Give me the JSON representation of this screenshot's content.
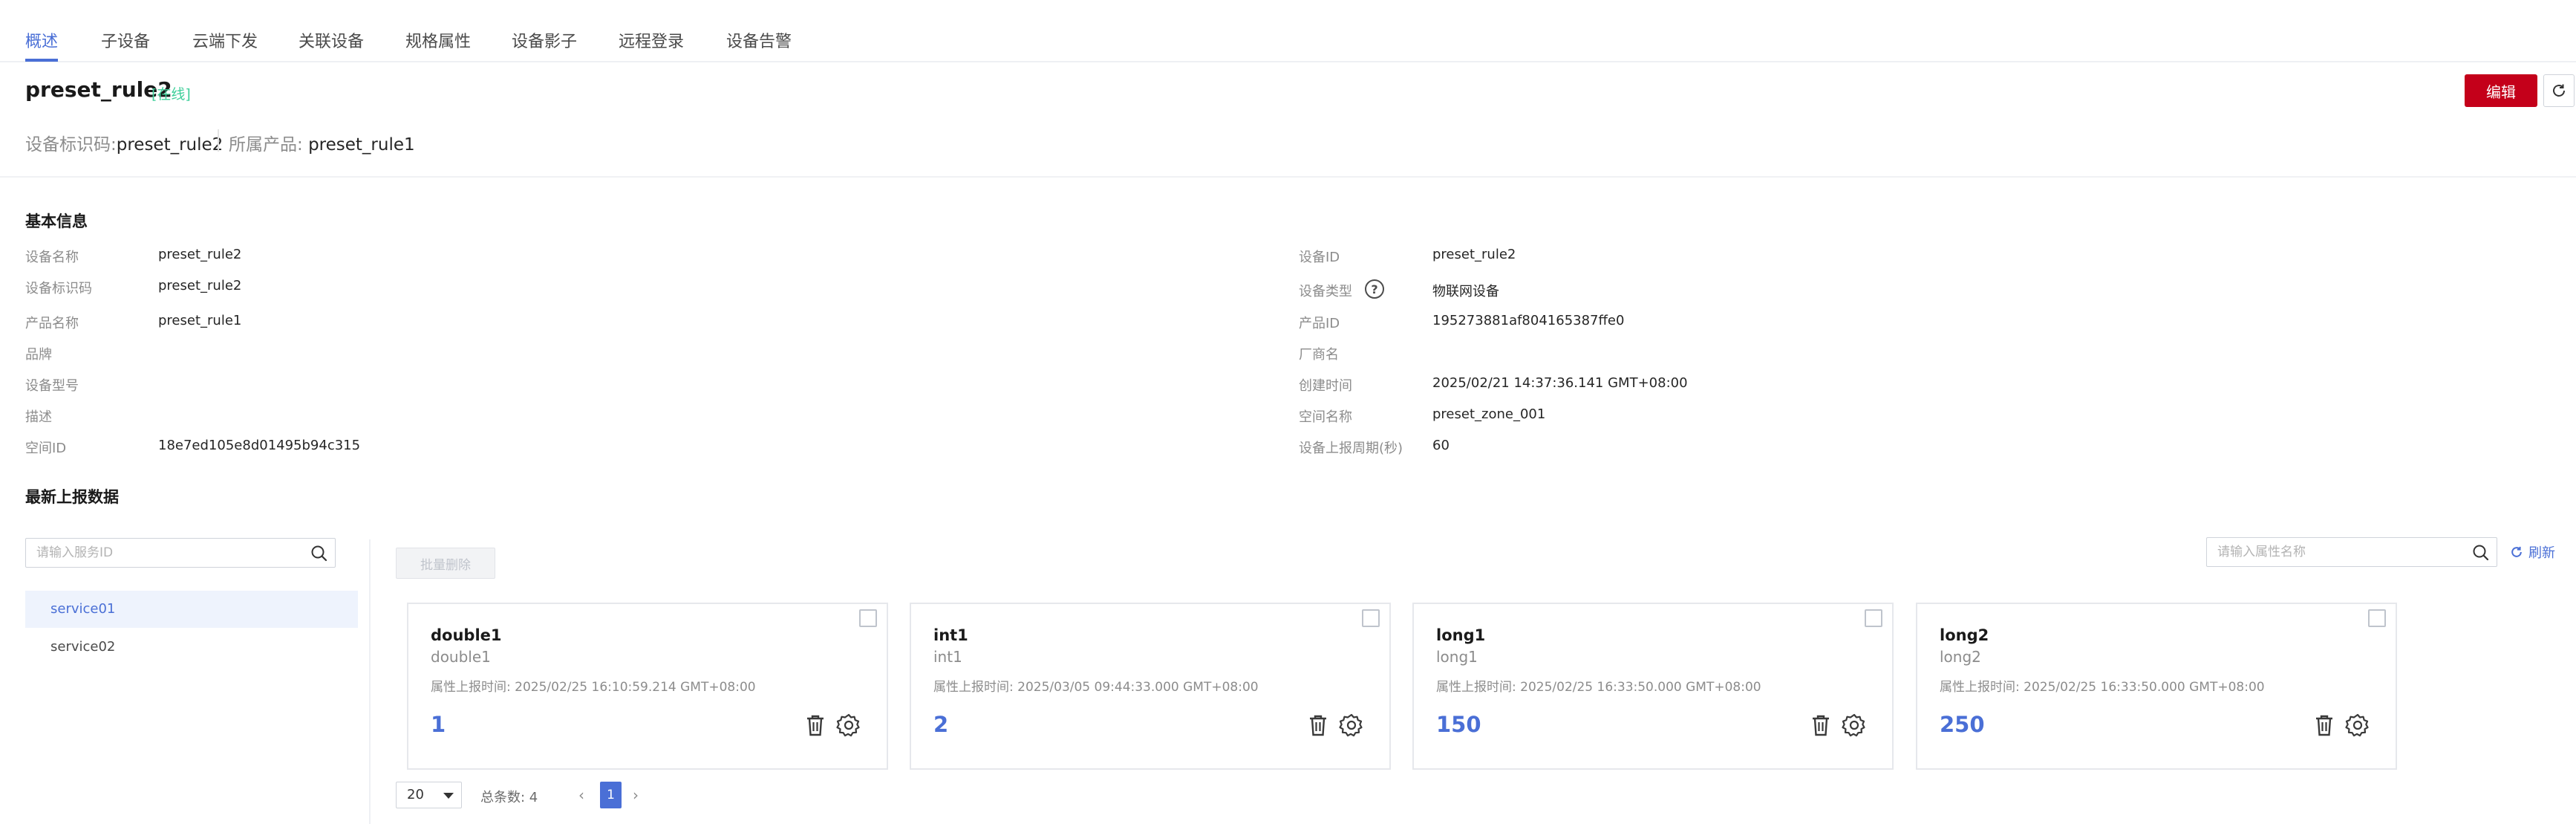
{
  "tabs": [
    "概述",
    "子设备",
    "云端下发",
    "关联设备",
    "规格属性",
    "设备影子",
    "远程登录",
    "设备告警"
  ],
  "header": {
    "device_name": "preset_rule2",
    "status": "[在线]",
    "edit_label": "编辑",
    "meta_code_label": "设备标识码:",
    "meta_code_value": "preset_rule2",
    "meta_product_label": "所属产品:",
    "meta_product_value": "preset_rule1"
  },
  "basic_info": {
    "title": "基本信息",
    "left": [
      {
        "label": "设备名称",
        "value": "preset_rule2"
      },
      {
        "label": "设备标识码",
        "value": "preset_rule2"
      },
      {
        "label": "产品名称",
        "value": "preset_rule1"
      },
      {
        "label": "品牌",
        "value": ""
      },
      {
        "label": "设备型号",
        "value": ""
      },
      {
        "label": "描述",
        "value": ""
      },
      {
        "label": "空间ID",
        "value": "18e7ed105e8d01495b94c315"
      }
    ],
    "right": [
      {
        "label": "设备ID",
        "value": "preset_rule2"
      },
      {
        "label": "设备类型",
        "value": "物联网设备"
      },
      {
        "label": "产品ID",
        "value": "195273881af804165387ffe0"
      },
      {
        "label": "厂商名",
        "value": ""
      },
      {
        "label": "创建时间",
        "value": "2025/02/21 14:37:36.141 GMT+08:00"
      },
      {
        "label": "空间名称",
        "value": "preset_zone_001"
      },
      {
        "label": "设备上报周期(秒)",
        "value": "60"
      }
    ],
    "help_glyph": "?"
  },
  "latest": {
    "title": "最新上报数据",
    "service_search_placeholder": "请输入服务ID",
    "services": [
      "service01",
      "service02"
    ],
    "batch_delete_label": "批量删除",
    "attr_search_placeholder": "请输入属性名称",
    "refresh_label": "刷新",
    "cards": [
      {
        "name": "double1",
        "sub": "double1",
        "time": "属性上报时间: 2025/02/25 16:10:59.214 GMT+08:00",
        "value": "1"
      },
      {
        "name": "int1",
        "sub": "int1",
        "time": "属性上报时间: 2025/03/05 09:44:33.000 GMT+08:00",
        "value": "2"
      },
      {
        "name": "long1",
        "sub": "long1",
        "time": "属性上报时间: 2025/02/25 16:33:50.000 GMT+08:00",
        "value": "150"
      },
      {
        "name": "long2",
        "sub": "long2",
        "time": "属性上报时间: 2025/02/25 16:33:50.000 GMT+08:00",
        "value": "250"
      }
    ]
  },
  "pagination": {
    "page_size": "20",
    "total_text": "总条数: 4",
    "prev": "‹",
    "next": "›",
    "current_page": "1"
  },
  "colors": {
    "accent": "#4a6fd6",
    "edit_button": "#c4001a",
    "online_status": "#3fcf9a"
  }
}
